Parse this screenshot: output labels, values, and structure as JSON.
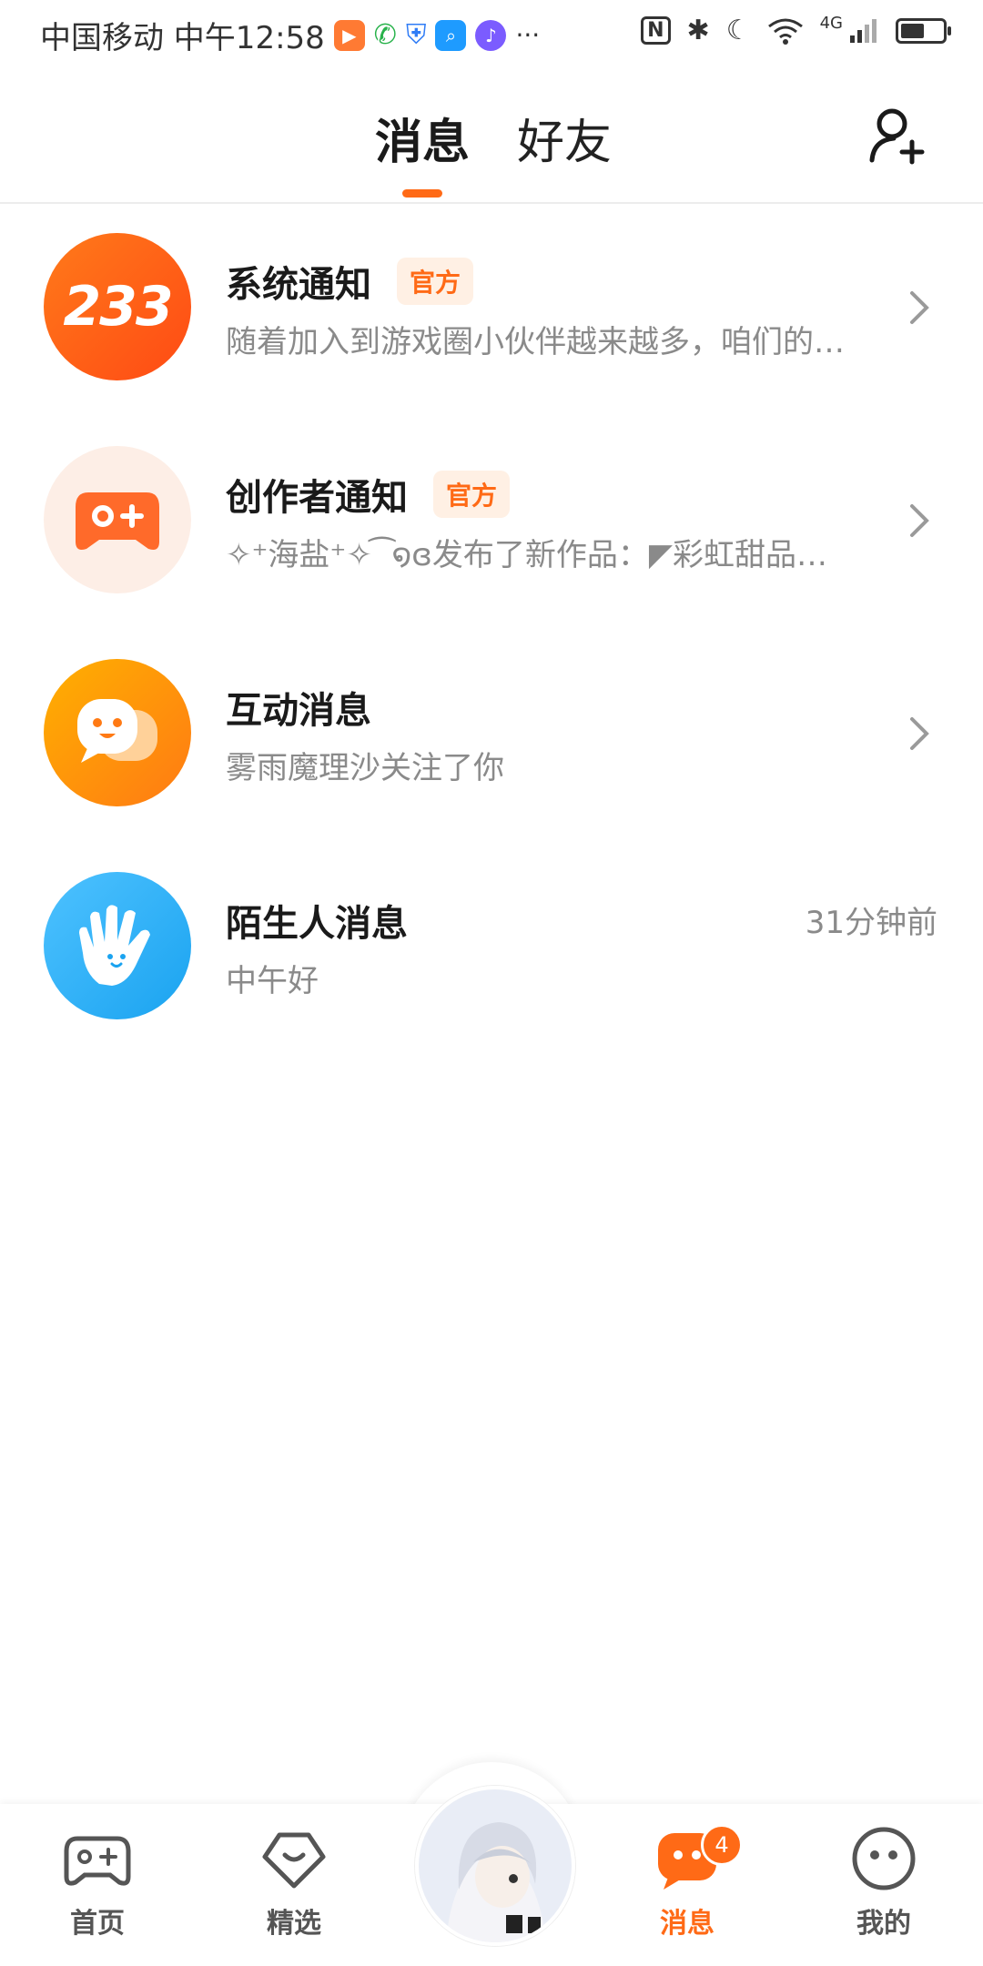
{
  "status_bar": {
    "carrier_time": "中国移动 中午12:58",
    "more": "···",
    "network": "4G"
  },
  "header": {
    "tab_messages": "消息",
    "tab_friends": "好友",
    "accent": "#ff6a16"
  },
  "messages": [
    {
      "title": "系统通知",
      "badge": "官方",
      "preview": "随着加入到游戏圈小伙伴越来越多，咱们的…",
      "avatar_text": "233"
    },
    {
      "title": "创作者通知",
      "badge": "官方",
      "preview": "✧⁺海盐⁺✧ ͡ ໑ɞ发布了新作品：◤彩虹甜品…"
    },
    {
      "title": "互动消息",
      "preview": "雾雨魔理沙关注了你"
    },
    {
      "title": "陌生人消息",
      "preview": "中午好",
      "time": "31分钟前"
    }
  ],
  "bottom_nav": {
    "home": "首页",
    "featured": "精选",
    "messages": "消息",
    "mine": "我的",
    "messages_count": "4"
  }
}
